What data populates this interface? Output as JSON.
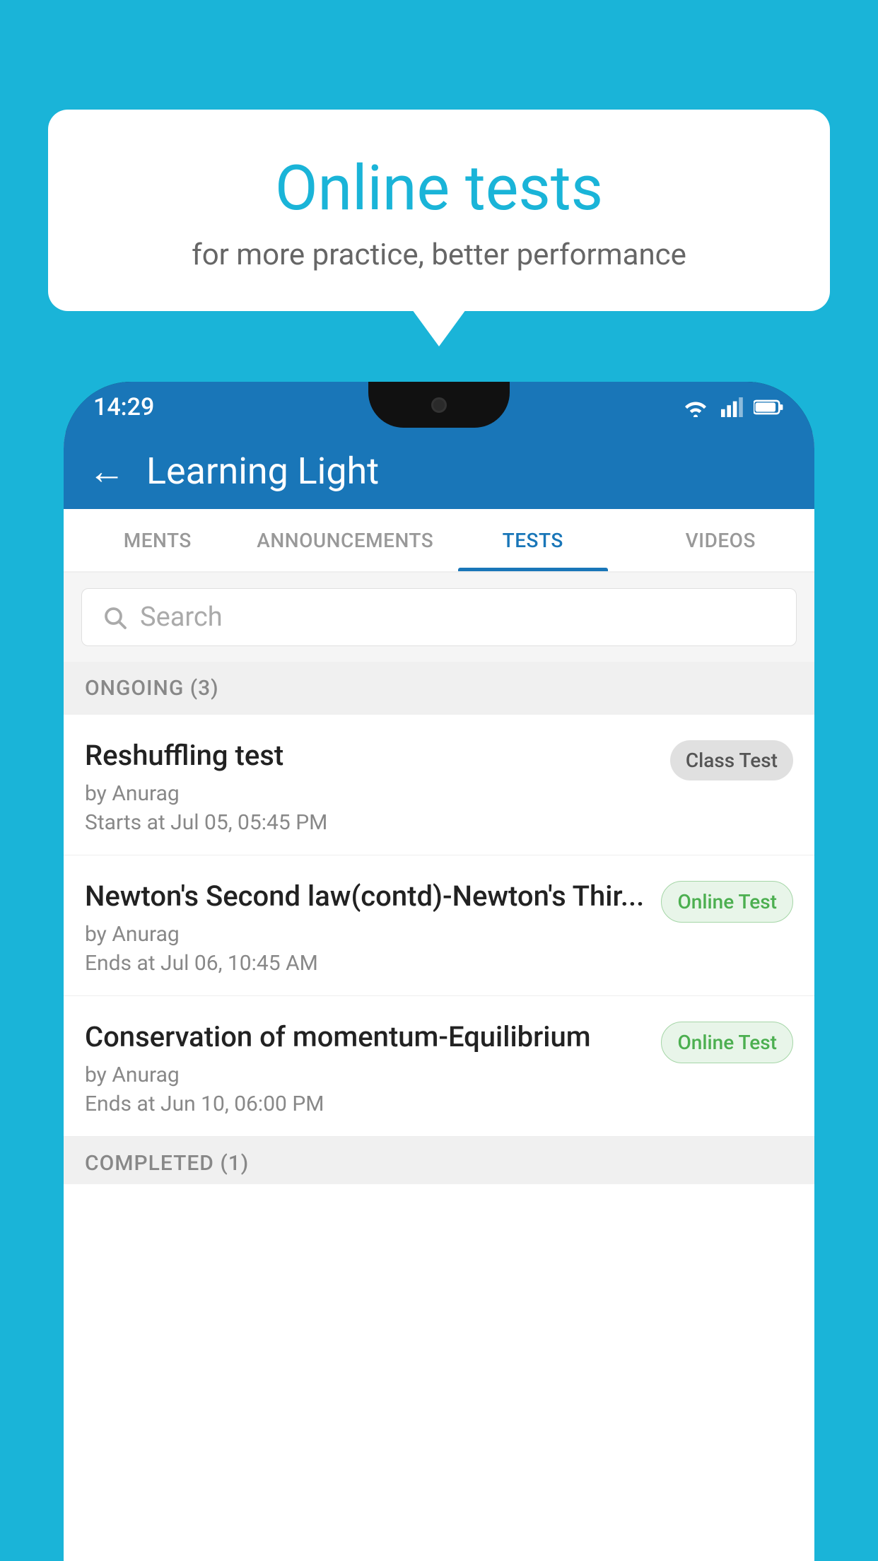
{
  "background_color": "#1ab4d8",
  "speech_bubble": {
    "title": "Online tests",
    "subtitle": "for more practice, better performance"
  },
  "status_bar": {
    "time": "14:29",
    "icons": [
      "wifi",
      "signal",
      "battery"
    ]
  },
  "app_bar": {
    "back_label": "←",
    "title": "Learning Light"
  },
  "tabs": [
    {
      "label": "MENTS",
      "active": false
    },
    {
      "label": "ANNOUNCEMENTS",
      "active": false
    },
    {
      "label": "TESTS",
      "active": true
    },
    {
      "label": "VIDEOS",
      "active": false
    }
  ],
  "search": {
    "placeholder": "Search"
  },
  "ongoing_section": {
    "label": "ONGOING (3)"
  },
  "tests": [
    {
      "title": "Reshuffling test",
      "by": "by Anurag",
      "date": "Starts at  Jul 05, 05:45 PM",
      "badge": "Class Test",
      "badge_type": "class"
    },
    {
      "title": "Newton's Second law(contd)-Newton's Thir...",
      "by": "by Anurag",
      "date": "Ends at  Jul 06, 10:45 AM",
      "badge": "Online Test",
      "badge_type": "online"
    },
    {
      "title": "Conservation of momentum-Equilibrium",
      "by": "by Anurag",
      "date": "Ends at  Jun 10, 06:00 PM",
      "badge": "Online Test",
      "badge_type": "online"
    }
  ],
  "completed_section": {
    "label": "COMPLETED (1)"
  }
}
